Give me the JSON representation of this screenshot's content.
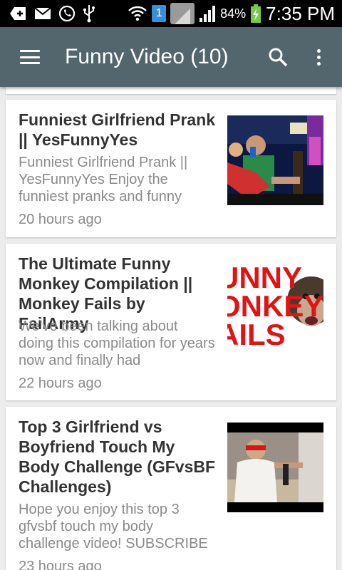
{
  "status_bar": {
    "sim_number": "1",
    "battery_percent": "84%",
    "time": "7:35 PM"
  },
  "app_bar": {
    "title": "Funny Video (10)"
  },
  "videos": [
    {
      "title": "Funniest Girlfriend Prank || YesFunnyYes",
      "description": "Funniest Girlfriend Prank || YesFunnyYes Enjoy the funniest pranks and funny",
      "time": "20 hours ago"
    },
    {
      "title": "The Ultimate Funny Monkey Compilation || Monkey Fails by FailArmy",
      "description": "We've been talking about doing this compilation for years now and finally had",
      "time": "22 hours ago",
      "thumb_text": [
        "UNNY",
        "ONKEY",
        "AILS"
      ]
    },
    {
      "title": "Top 3 Girlfriend vs Boyfriend Touch My Body Challenge (GFvsBF Challenges)",
      "description": "Hope you enjoy this top 3 gfvsbf touch my body challenge video! SUBSCRIBE",
      "time": "23 hours ago"
    }
  ]
}
